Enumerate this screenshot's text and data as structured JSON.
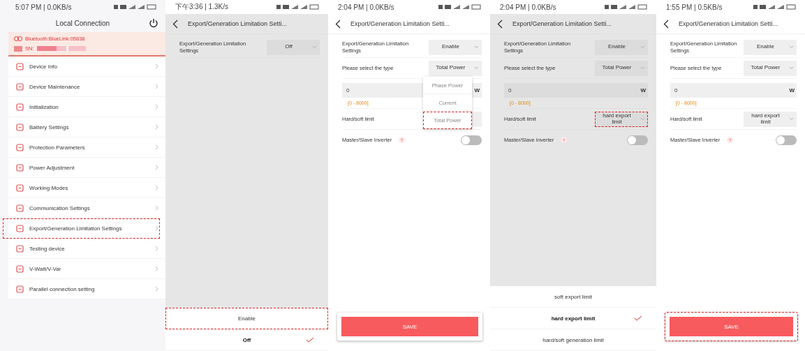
{
  "panels": [
    {
      "kind": "menu",
      "status": "5:07 PM | 0.0KB/s",
      "title": "Local Connection",
      "bluetooth": "Bluetooth:BlueLink:05838",
      "sn_label": "SN:",
      "items": [
        {
          "label": "Device Info",
          "highlighted": false
        },
        {
          "label": "Device Maintenance",
          "highlighted": false
        },
        {
          "label": "Initialization",
          "highlighted": false
        },
        {
          "label": "Battery Settings",
          "highlighted": false
        },
        {
          "label": "Protection Parameters",
          "highlighted": false
        },
        {
          "label": "Power Adjustment",
          "highlighted": false
        },
        {
          "label": "Working Modes",
          "highlighted": false
        },
        {
          "label": "Communication Settings",
          "highlighted": false
        },
        {
          "label": "Export/Generation Limitation Settings",
          "highlighted": true
        },
        {
          "label": "Testing device",
          "highlighted": false
        },
        {
          "label": "V-Watt/V-Var",
          "highlighted": false
        },
        {
          "label": "Parallel connection setting",
          "highlighted": false
        }
      ]
    },
    {
      "kind": "form",
      "status": "下午3:36 | 1.3K/s",
      "title": "Export/Generation Limitation Setti...",
      "dimmed": true,
      "fields": [
        {
          "kind": "select",
          "label": "Export/Generation Limitation Settings",
          "value": "Off",
          "highlighted": false
        }
      ],
      "sheet": [
        {
          "label": "Enable",
          "selected": false,
          "highlighted": true
        },
        {
          "label": "Off",
          "selected": true,
          "highlighted": false
        }
      ]
    },
    {
      "kind": "form",
      "status": "2:04 PM | 0.0KB/s",
      "title": "Export/Generation Limitation Setti...",
      "dimmed": false,
      "fields": [
        {
          "kind": "select",
          "label": "Export/Generation Limitation Settings",
          "value": "Enable",
          "highlighted": false
        },
        {
          "kind": "select",
          "label": "Please select the type",
          "value": "Total Power",
          "highlighted": false,
          "popup": [
            {
              "label": "Phase Power",
              "highlighted": false
            },
            {
              "label": "Current",
              "highlighted": false
            },
            {
              "label": "Total Power",
              "highlighted": true
            }
          ]
        },
        {
          "kind": "input",
          "value": "0",
          "unit": "W",
          "hint": "[0 - 8000]"
        },
        {
          "kind": "select",
          "label": "Hard/soft limit",
          "highlighted": false
        },
        {
          "kind": "toggle",
          "label": "Master/Slave Inverter",
          "help": "?",
          "on": false
        }
      ],
      "save": {
        "label": "SAVE",
        "highlighted": false
      }
    },
    {
      "kind": "form",
      "status": "2:04 PM | 0.0KB/s",
      "title": "Export/Generation Limitation Setti...",
      "dimmed": true,
      "fields": [
        {
          "kind": "select",
          "label": "Export/Generation Limitation Settings",
          "value": "Enable",
          "highlighted": false
        },
        {
          "kind": "select",
          "label": "Please select the type",
          "value": "Total Power",
          "highlighted": false
        },
        {
          "kind": "input",
          "value": "0",
          "unit": "W",
          "hint": "[0 - 8000]"
        },
        {
          "kind": "select",
          "label": "Hard/soft limit",
          "value": "hard export limit",
          "highlighted": true
        },
        {
          "kind": "toggle",
          "label": "Master/Slave Inverter",
          "help": "?",
          "on": false
        }
      ],
      "sheet": [
        {
          "label": "soft export limit",
          "selected": false,
          "highlighted": false
        },
        {
          "label": "hard export limit",
          "selected": true,
          "highlighted": false
        },
        {
          "label": "hard/soft generation limit",
          "selected": false,
          "highlighted": false
        }
      ]
    },
    {
      "kind": "form",
      "status": "1:55 PM | 0.5KB/s",
      "title": "Export/Generation Limitation Setti...",
      "dimmed": false,
      "fields": [
        {
          "kind": "select",
          "label": "Export/Generation Limitation Settings",
          "value": "Enable",
          "highlighted": false
        },
        {
          "kind": "select",
          "label": "Please select the type",
          "value": "Total Power",
          "highlighted": false
        },
        {
          "kind": "input",
          "value": "0",
          "unit": "W",
          "hint": "[0 - 8000]"
        },
        {
          "kind": "select",
          "label": "Hard/soft limit",
          "value": "hard export limit",
          "highlighted": false
        },
        {
          "kind": "toggle",
          "label": "Master/Slave Inverter",
          "help": "?",
          "on": false
        }
      ],
      "save": {
        "label": "SAVE",
        "highlighted": true
      }
    }
  ]
}
